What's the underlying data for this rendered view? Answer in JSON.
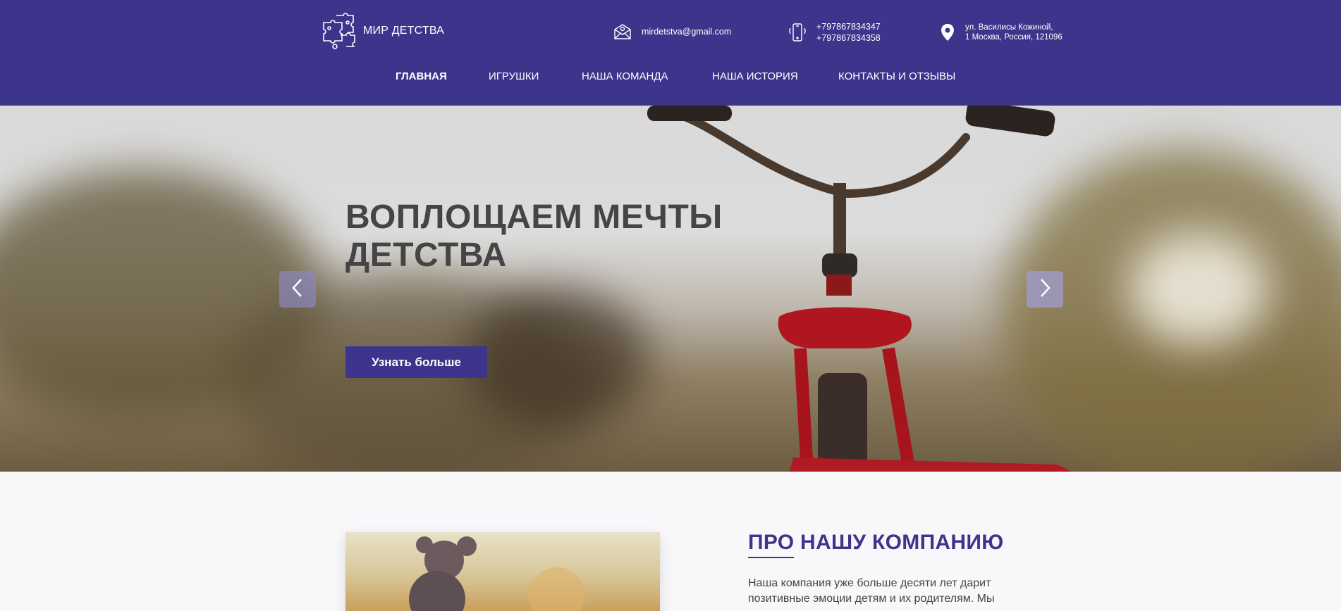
{
  "header": {
    "logo_text": "МИР ДЕТСТВА",
    "email": "mirdetstva@gmail.com",
    "phones": [
      "+797867834347",
      "+797867834358"
    ],
    "address_lines": [
      "ул. Василисы Кожиной,",
      "1 Москва, Россия, 121096"
    ],
    "icons": [
      "puzzle-logo-icon",
      "envelope-icon",
      "phone-icon",
      "map-pin-icon"
    ]
  },
  "nav": {
    "items": [
      {
        "label": "ГЛАВНАЯ",
        "active": true
      },
      {
        "label": "ИГРУШКИ",
        "active": false
      },
      {
        "label": "НАША КОМАНДА",
        "active": false
      },
      {
        "label": "НАША ИСТОРИЯ",
        "active": false
      },
      {
        "label": "КОНТАКТЫ И ОТЗЫВЫ",
        "active": false
      }
    ]
  },
  "hero": {
    "title_lines": [
      "ВОПЛОЩАЕМ МЕЧТЫ",
      "ДЕТСТВА"
    ],
    "button_label": "Узнать больше",
    "prev_icon": "chevron-left-icon",
    "next_icon": "chevron-right-icon"
  },
  "about": {
    "title_underlined": "ПРО",
    "title_rest": " НАШУ КОМПАНИЮ",
    "text": "Наша компания уже больше десяти лет дарит позитивные эмоции детям и их родителям. Мы"
  },
  "colors": {
    "brand": "#3d348b",
    "heading_gray": "#454545",
    "page_bg": "#f8f8fb"
  }
}
